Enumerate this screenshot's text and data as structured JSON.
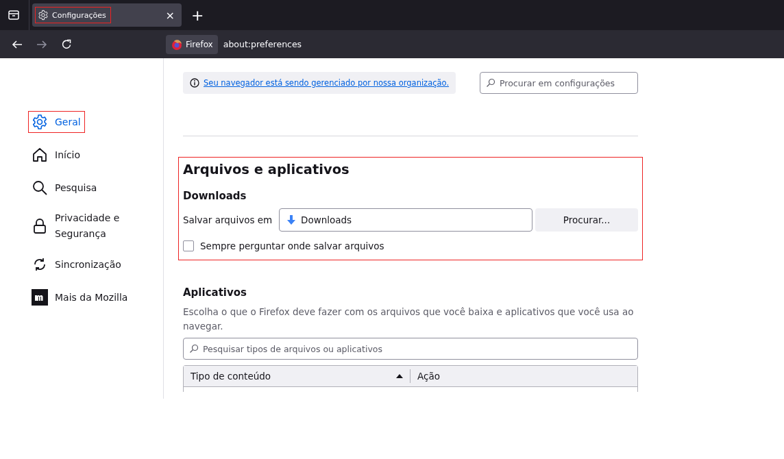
{
  "tab_bar": {
    "tabs": [
      {
        "title": "Configurações",
        "selected": true,
        "highlighted": true,
        "close": "×"
      }
    ],
    "new_tab": "+"
  },
  "nav_bar": {
    "identity": "Firefox",
    "url": "about:preferences"
  },
  "sidebar": {
    "items": [
      {
        "label": "Geral",
        "kind": "gear",
        "selected": true,
        "highlighted": true
      },
      {
        "label": "Início",
        "kind": "home",
        "selected": false,
        "highlighted": false
      },
      {
        "label": "Pesquisa",
        "kind": "search",
        "selected": false,
        "highlighted": false
      },
      {
        "label": "Privacidade e Segurança",
        "kind": "lock",
        "selected": false,
        "highlighted": false
      },
      {
        "label": "Sincronização",
        "kind": "sync",
        "selected": false,
        "highlighted": false
      },
      {
        "label": "Mais da Mozilla",
        "kind": "mozilla",
        "selected": false,
        "highlighted": false
      }
    ]
  },
  "policy_notice": "Seu navegador está sendo gerenciado por nossa organização.",
  "search": {
    "placeholder": "Procurar em configurações"
  },
  "files_section": {
    "title": "Arquivos e aplicativos",
    "highlighted": true,
    "subtitle": "Downloads",
    "save_label": "Salvar arquivos em",
    "save_folder": "Downloads",
    "browse_button": "Procurar...",
    "always_ask": {
      "label": "Sempre perguntar onde salvar arquivos",
      "checked": false
    }
  },
  "apps_section": {
    "title": "Aplicativos",
    "description": "Escolha o que o Firefox deve fazer com os arquivos que você baixa e aplicativos que você usa ao navegar.",
    "search": {
      "placeholder": "Pesquisar tipos de arquivos ou aplicativos"
    },
    "table": {
      "columns": [
        {
          "label": "Tipo de conteúdo",
          "sorted": true
        },
        {
          "label": "Ação",
          "sorted": false
        }
      ]
    }
  }
}
